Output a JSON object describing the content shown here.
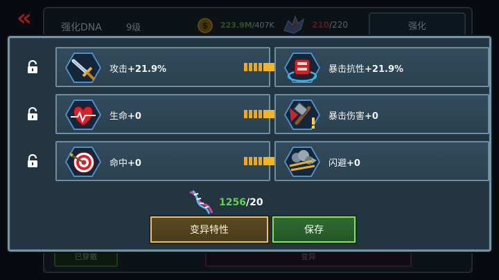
{
  "background": {
    "back_glyph": "«",
    "title": "强化DNA",
    "level": "9级",
    "coin_glyph": "$",
    "coin_have": "223.9M",
    "coin_total": "/407K",
    "dna_rep_have": "210",
    "dna_rep_total": "/220",
    "tab_label": "强化",
    "bottom_left_button": "已穿戴",
    "bottom_right_button": "变异"
  },
  "traits": [
    {
      "left_icon": "sword-icon",
      "left_label": "攻击",
      "left_value": "+21.9%",
      "right_icon": "armor-icon",
      "right_label": "暴击抗性",
      "right_value": "+21.9%"
    },
    {
      "left_icon": "heart-icon",
      "left_label": "生命",
      "left_value": "+0",
      "right_icon": "hammer-icon",
      "right_label": "暴击伤害",
      "right_value": "+0"
    },
    {
      "left_icon": "target-icon",
      "left_label": "命中",
      "left_value": "+0",
      "right_icon": "dodge-icon",
      "right_label": "闪避",
      "right_value": "+0"
    }
  ],
  "dna": {
    "icon": "dna-icon",
    "have": "1256",
    "need": "/20"
  },
  "buttons": {
    "mutate": "变异特性",
    "save": "保存"
  },
  "colors": {
    "accent_green": "#5fd34a",
    "mutate_border": "#e1c174",
    "save_border": "#8fdc6b",
    "back_red": "#e2322b"
  }
}
